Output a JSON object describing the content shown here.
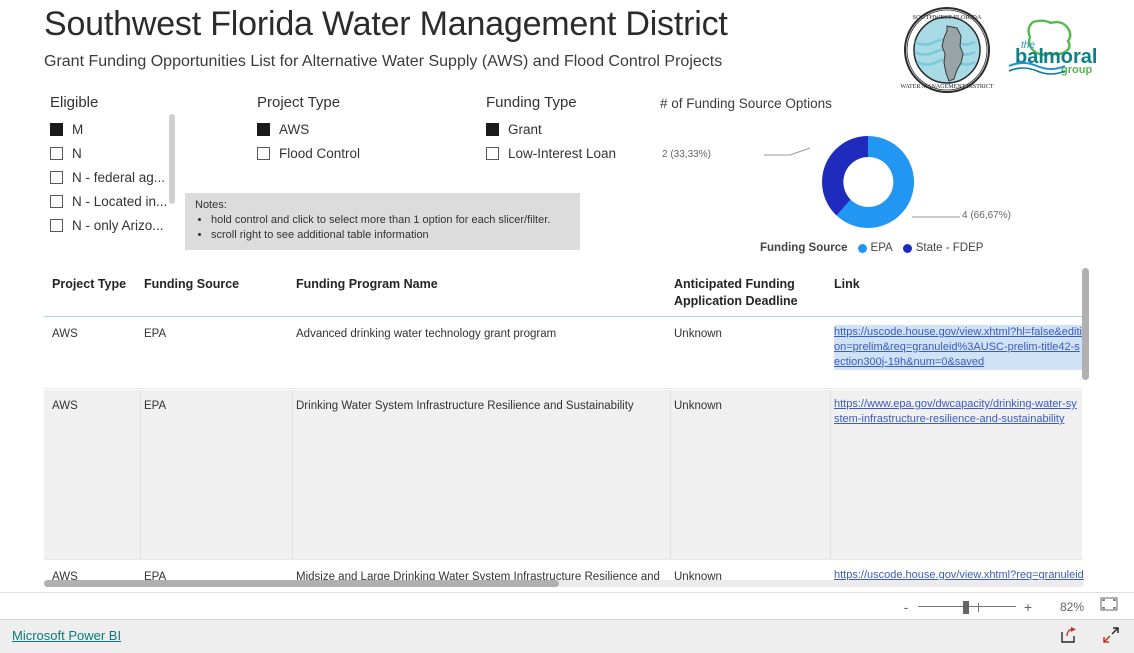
{
  "header": {
    "title": "Southwest Florida Water Management District",
    "subtitle": "Grant Funding Opportunities List for Alternative Water Supply (AWS) and Flood Control Projects",
    "logo_primary": "swfwmd-seal-logo",
    "logo_secondary": "the-balmoral-group-logo"
  },
  "slicers": [
    {
      "title": "Eligible",
      "items": [
        {
          "label": "M",
          "checked": true
        },
        {
          "label": "N",
          "checked": false
        },
        {
          "label": "N - federal ag...",
          "checked": false
        },
        {
          "label": "N - Located in...",
          "checked": false
        },
        {
          "label": "N - only Arizo...",
          "checked": false
        }
      ]
    },
    {
      "title": "Project Type",
      "items": [
        {
          "label": "AWS",
          "checked": true
        },
        {
          "label": "Flood Control",
          "checked": false
        }
      ]
    },
    {
      "title": "Funding Type",
      "items": [
        {
          "label": "Grant",
          "checked": true
        },
        {
          "label": "Low-Interest Loan",
          "checked": false
        }
      ]
    }
  ],
  "notes": {
    "title": "Notes:",
    "items": [
      "hold control and click to select more than 1 option for each slicer/filter.",
      "scroll right to see additional table information"
    ]
  },
  "chart_data": {
    "type": "pie",
    "title": "# of Funding Source Options",
    "categories": [
      "EPA",
      "State - FDEP"
    ],
    "values": [
      4,
      2
    ],
    "data_labels": [
      "4 (66,67%)",
      "2 (33,33%)"
    ],
    "colors": [
      "#2196f3",
      "#1f2bbd"
    ],
    "legend_title": "Funding Source",
    "legend_position": "bottom",
    "donut": true,
    "grid": false
  },
  "table": {
    "columns": [
      "Project Type",
      "Funding Source",
      "Funding Program Name",
      "Anticipated Funding Application Deadline",
      "Link"
    ],
    "rows": [
      {
        "project_type": "AWS",
        "funding_source": "EPA",
        "program_name": "Advanced drinking water technology grant program",
        "deadline": "Unknown",
        "link": "https://uscode.house.gov/view.xhtml?hl=false&edition=prelim&req=granuleid%3AUSC-prelim-title42-section300j-19h&num=0&saved",
        "link_selected": true
      },
      {
        "project_type": "AWS",
        "funding_source": "EPA",
        "program_name": "Drinking Water System Infrastructure Resilience and Sustainability",
        "deadline": "Unknown",
        "link": "https://www.epa.gov/dwcapacity/drinking-water-system-infrastructure-resilience-and-sustainability",
        "link_selected": false
      },
      {
        "project_type": "AWS",
        "funding_source": "EPA",
        "program_name": "Midsize and Large Drinking Water System Infrastructure Resilience and",
        "deadline": "Unknown",
        "link": "https://uscode.house.gov/view.xhtml?req=granuleid",
        "link_selected": false
      }
    ]
  },
  "statusbar": {
    "zoom_out": "-",
    "zoom_in": "+",
    "zoom_level": "82%",
    "fit_icon": "fit-to-page-icon"
  },
  "footer": {
    "brand": "Microsoft Power BI",
    "share_icon": "share-icon",
    "fullscreen_icon": "fullscreen-icon"
  }
}
